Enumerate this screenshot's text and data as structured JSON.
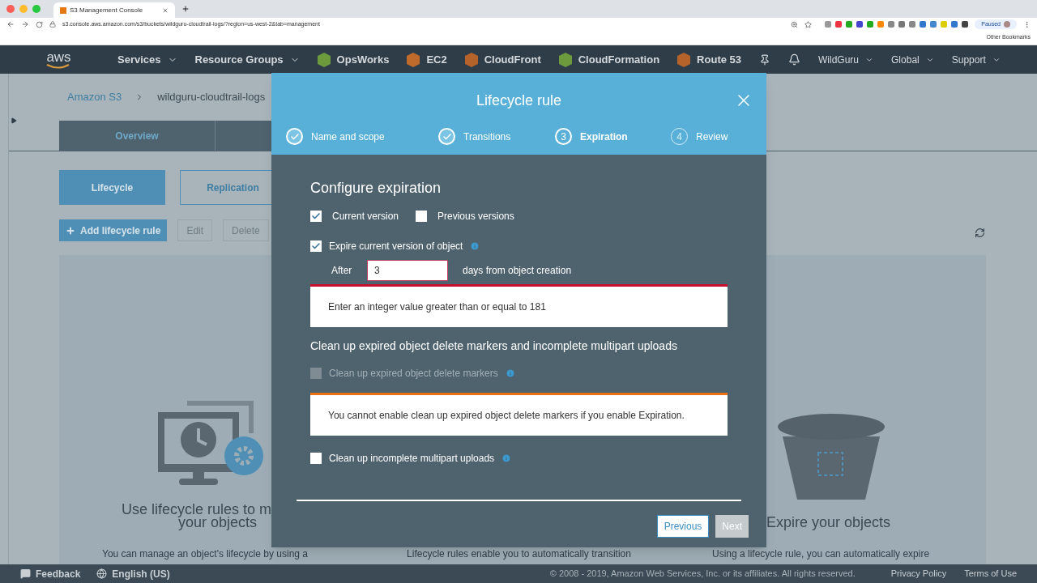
{
  "browser": {
    "tab_title": "S3 Management Console",
    "url": "s3.console.aws.amazon.com/s3/buckets/wildguru-cloudtrail-logs/?region=us-west-2&tab=management",
    "profile": "Paused",
    "bookmarks": "Other Bookmarks"
  },
  "nav": {
    "logo": "aws",
    "items": [
      {
        "label": "Services",
        "kind": "menu"
      },
      {
        "label": "Resource Groups",
        "kind": "menu"
      },
      {
        "label": "OpsWorks",
        "kind": "service",
        "color": "#6c9a3c"
      },
      {
        "label": "EC2",
        "kind": "service",
        "color": "#c06a2b"
      },
      {
        "label": "CloudFront",
        "kind": "service",
        "color": "#b5622b"
      },
      {
        "label": "CloudFormation",
        "kind": "service",
        "color": "#6c9a3c"
      },
      {
        "label": "Route 53",
        "kind": "service",
        "color": "#b5622b"
      }
    ],
    "right": [
      {
        "label": "WildGuru"
      },
      {
        "label": "Global"
      },
      {
        "label": "Support"
      }
    ]
  },
  "page": {
    "breadcrumb": [
      "Amazon S3",
      "wildguru-cloudtrail-logs"
    ],
    "tabs": [
      {
        "label": "Overview",
        "selected": false
      }
    ],
    "subtabs": [
      {
        "label": "Lifecycle",
        "selected": true
      },
      {
        "label": "Replication",
        "selected": false
      }
    ],
    "actions": [
      {
        "label": "Add lifecycle rule",
        "disabled": false
      },
      {
        "label": "Edit",
        "disabled": true
      },
      {
        "label": "Delete",
        "disabled": true
      }
    ],
    "cards": [
      {
        "title": [
          "Use lifecycle rules to m",
          "your objects"
        ],
        "text": "You can manage an object's lifecycle by using a",
        "kind": "monitor"
      },
      {
        "text": "Lifecycle rules enable you to automatically transition",
        "kind": "none"
      },
      {
        "title": [
          "Expire your objects"
        ],
        "text": "Using a lifecycle rule, you can automatically expire",
        "kind": "bucket"
      }
    ]
  },
  "modal": {
    "title": "Lifecycle rule",
    "steps": [
      {
        "label": "Name and scope",
        "completed": true,
        "selected": false
      },
      {
        "label": "Transitions",
        "completed": true,
        "selected": false
      },
      {
        "number": "3",
        "label": "Expiration",
        "completed": false,
        "selected": true
      },
      {
        "number": "4",
        "label": "Review",
        "completed": false,
        "selected": false
      }
    ],
    "heading": "Configure expiration",
    "versions": [
      {
        "label": "Current version",
        "checked": true
      },
      {
        "label": "Previous versions",
        "checked": false
      }
    ],
    "expire": {
      "label": "Expire current version of object",
      "checked": true
    },
    "after": {
      "label": "After",
      "value": "3",
      "suffix": "days from object creation",
      "error": "Enter an integer value greater than or equal to 181"
    },
    "cleanup_heading": "Clean up expired object delete markers and incomplete multipart uploads",
    "markers": {
      "label": "Clean up expired object delete markers",
      "checked": false,
      "disabled": true,
      "warning": "You cannot enable clean up expired object delete markers if you enable Expiration."
    },
    "multipart": {
      "label": "Clean up incomplete multipart uploads",
      "checked": false
    },
    "buttons": [
      {
        "label": "Previous",
        "disabled": false
      },
      {
        "label": "Next",
        "disabled": true
      }
    ]
  },
  "footer": {
    "left": [
      {
        "label": "Feedback",
        "kind": "feedback"
      },
      {
        "label": "English (US)",
        "kind": "language"
      }
    ],
    "copyright": "© 2008 - 2019, Amazon Web Services, Inc. or its affiliates. All rights reserved.",
    "links": [
      "Privacy Policy",
      "Terms of Use"
    ]
  }
}
